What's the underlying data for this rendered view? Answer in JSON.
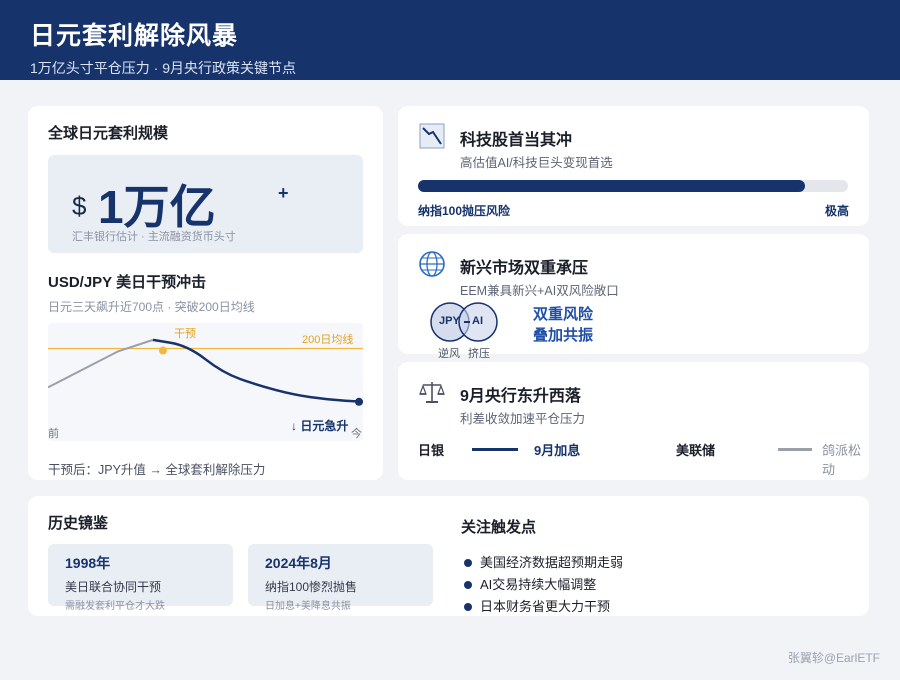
{
  "header": {
    "title": "日元套利解除风暴",
    "subtitle": "1万亿头寸平仓压力 · 9月央行政策关键节点"
  },
  "scale": {
    "title": "全球日元套利规模",
    "currency": "$",
    "amount": "1万亿",
    "plus": "+",
    "note": "汇丰银行估计 · 主流融资货币头寸"
  },
  "usdjpy": {
    "title": "USD/JPY 美日干预冲击",
    "note": "日元三天飙升近700点 · 突破200日均线",
    "footer": "干预后：JPY升值 → 全球套利解除压力"
  },
  "chart_data": {
    "type": "line",
    "x_labels": [
      "前",
      "今"
    ],
    "ma_label": "200日均线",
    "intervention_label": "干预",
    "drop_label": "↓ 日元急升",
    "series": [
      {
        "values": [
          0.3,
          0.55,
          0.8,
          0.96,
          0.88,
          0.5,
          0.33,
          0.2,
          0.13,
          0.1
        ]
      }
    ],
    "ma_level": 0.84,
    "intervention_index": 3,
    "ylim": [
      0,
      1
    ],
    "grid": false,
    "colors": {
      "line": "#16336b",
      "ma": "#f2b73f",
      "pre": "#9aa0aa"
    }
  },
  "tech": {
    "title": "科技股首当其冲",
    "subtitle": "高估值AI/科技巨头变现首选",
    "bar_left": "纳指100抛压风险",
    "bar_right": "极高",
    "level": 0.9,
    "icon": "falling-chart-icon"
  },
  "em": {
    "title": "新兴市场双重承压",
    "subtitle": "EEM兼具新兴+AI双风险敞口",
    "venn_left": "JPY",
    "venn_right": "AI",
    "label_left": "逆风",
    "label_right": "挤压",
    "risk_line1": "双重风险",
    "risk_line2": "叠加共振",
    "icon": "globe-icon"
  },
  "cb": {
    "title": "9月央行东升西落",
    "subtitle": "利差收敛加速平仓压力",
    "boj_name": "日银",
    "boj_value": "9月加息",
    "fed_name": "美联储",
    "fed_value": "鸽派松动",
    "icon": "balance-scale-icon"
  },
  "history": {
    "title": "历史镜鉴",
    "items": [
      {
        "year": "1998年",
        "desc": "美日联合协同干预",
        "sub": "需融发套利平仓才大跌"
      },
      {
        "year": "2024年8月",
        "desc": "纳指100惨烈抛售",
        "sub": "日加息+美降息共振"
      }
    ]
  },
  "triggers": {
    "title": "关注触发点",
    "items": [
      "美国经济数据超预期走弱",
      "AI交易持续大幅调整",
      "日本财务省更大力干预"
    ]
  },
  "credit": "张翼轸@EarlETF",
  "colors": {
    "navy": "#16336b",
    "accent": "#1f4fa8",
    "gold": "#f2b73f",
    "grey": "#9aa0aa"
  }
}
